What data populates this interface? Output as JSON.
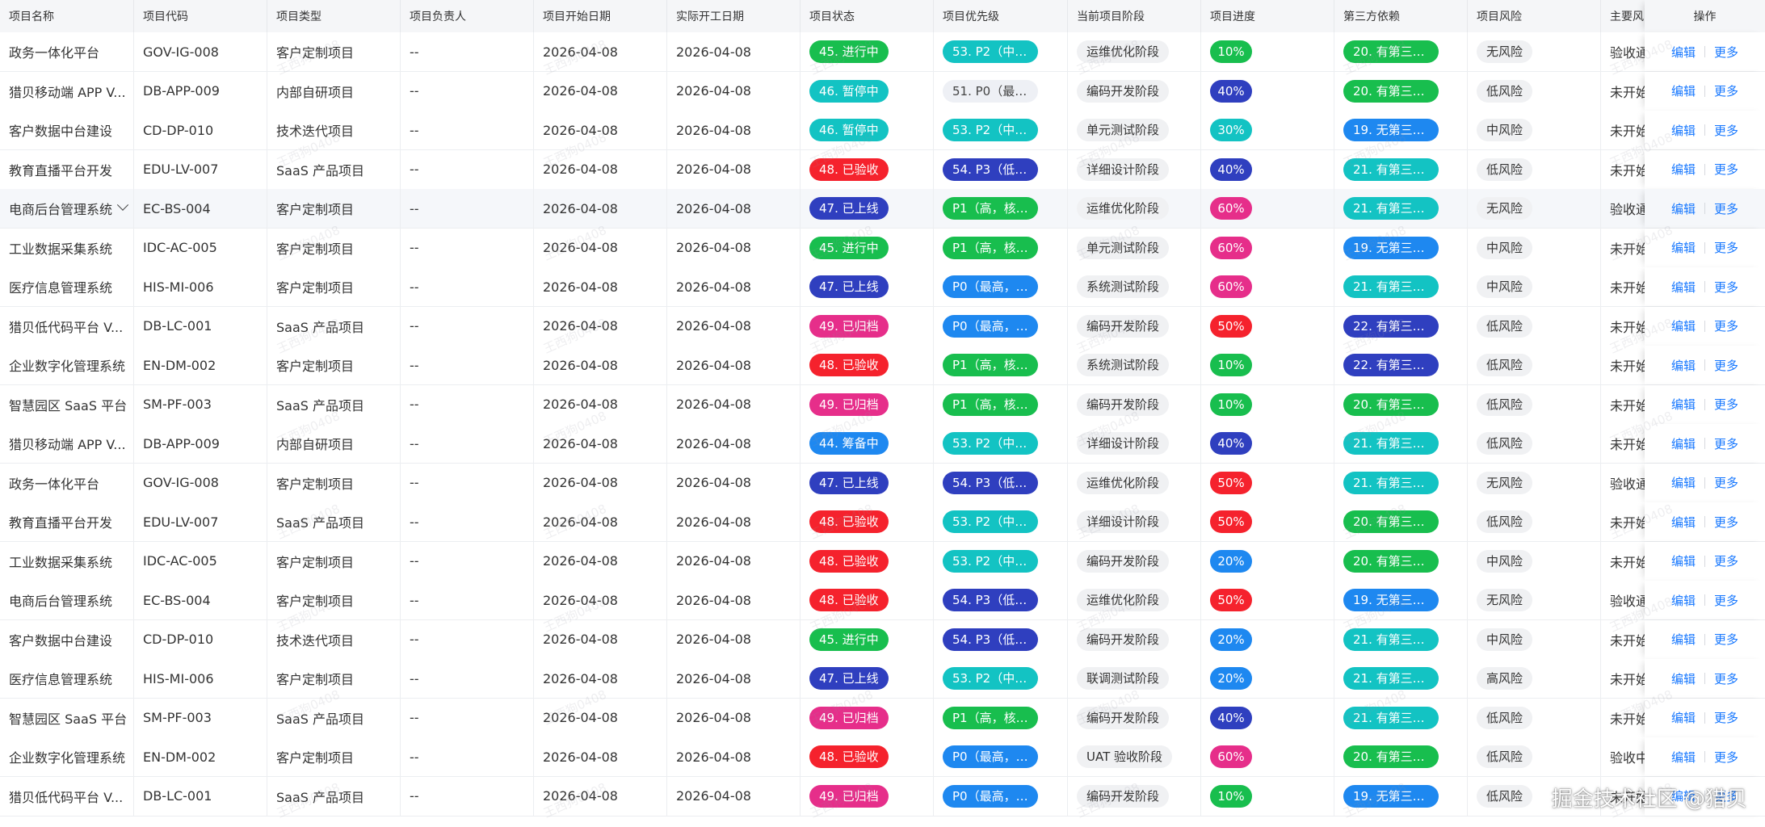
{
  "columns": [
    "项目名称",
    "项目代码",
    "项目类型",
    "项目负责人",
    "项目开始日期",
    "实际开工日期",
    "项目状态",
    "项目优先级",
    "当前项目阶段",
    "项目进度",
    "第三方依赖",
    "项目风险",
    "主要风",
    "操作"
  ],
  "actions": {
    "edit": "编辑",
    "more": "更多"
  },
  "watermark_text": "王西狗0408",
  "brand_text": "掘金技术社区 @猎贝",
  "colors": {
    "green": "#18be4e",
    "teal": "#13c3c3",
    "blue": "#1e88f0",
    "indigo": "#2f3fbf",
    "red": "#f5222d",
    "magenta": "#e62e8a",
    "light": "#eef0f5",
    "link": "#1677ff"
  },
  "rows": [
    {
      "name": "政务一体化平台",
      "code": "GOV-IG-008",
      "type": "客户定制项目",
      "owner": "--",
      "start": "2026-04-08",
      "actual": "2026-04-08",
      "status": "45. 进行中",
      "status_color": "green",
      "priority": "53. P2（中，常...",
      "priority_color": "teal",
      "stage": "运维优化阶段",
      "progress": "10%",
      "progress_color": "green",
      "dependency": "20. 有第三方接...",
      "dependency_color": "green",
      "risk": "无风险",
      "main_risk": "验收通"
    },
    {
      "name": "猎贝移动端 APP V...",
      "code": "DB-APP-009",
      "type": "内部自研项目",
      "owner": "--",
      "start": "2026-04-08",
      "actual": "2026-04-08",
      "status": "46. 暂停中",
      "status_color": "teal",
      "priority": "51. P0（最高，...",
      "priority_color": "light",
      "stage": "编码开发阶段",
      "progress": "40%",
      "progress_color": "indigo",
      "dependency": "20. 有第三方接...",
      "dependency_color": "green",
      "risk": "低风险",
      "main_risk": "未开始"
    },
    {
      "name": "客户数据中台建设",
      "code": "CD-DP-010",
      "type": "技术迭代项目",
      "owner": "--",
      "start": "2026-04-08",
      "actual": "2026-04-08",
      "status": "46. 暂停中",
      "status_color": "teal",
      "priority": "53. P2（中，常...",
      "priority_color": "teal",
      "stage": "单元测试阶段",
      "progress": "30%",
      "progress_color": "teal",
      "dependency": "19. 无第三方依赖",
      "dependency_color": "blue",
      "risk": "中风险",
      "main_risk": "未开始"
    },
    {
      "name": "教育直播平台开发",
      "code": "EDU-LV-007",
      "type": "SaaS 产品项目",
      "owner": "--",
      "start": "2026-04-08",
      "actual": "2026-04-08",
      "status": "48. 已验收",
      "status_color": "red",
      "priority": "54. P3（低，优...",
      "priority_color": "indigo",
      "stage": "详细设计阶段",
      "progress": "40%",
      "progress_color": "indigo",
      "dependency": "21. 有第三方组...",
      "dependency_color": "teal",
      "risk": "低风险",
      "main_risk": "未开始"
    },
    {
      "name": "电商后台管理系统",
      "code": "EC-BS-004",
      "type": "客户定制项目",
      "owner": "--",
      "start": "2026-04-08",
      "actual": "2026-04-08",
      "status": "47. 已上线",
      "status_color": "indigo",
      "priority": "P1（高，核心...",
      "priority_color": "green",
      "stage": "运维优化阶段",
      "progress": "60%",
      "progress_color": "magenta",
      "dependency": "21. 有第三方组...",
      "dependency_color": "teal",
      "risk": "无风险",
      "main_risk": "验收通"
    },
    {
      "name": "工业数据采集系统",
      "code": "IDC-AC-005",
      "type": "客户定制项目",
      "owner": "--",
      "start": "2026-04-08",
      "actual": "2026-04-08",
      "status": "45. 进行中",
      "status_color": "green",
      "priority": "P1（高，核心...",
      "priority_color": "green",
      "stage": "单元测试阶段",
      "progress": "60%",
      "progress_color": "magenta",
      "dependency": "19. 无第三方依赖",
      "dependency_color": "blue",
      "risk": "中风险",
      "main_risk": "未开始"
    },
    {
      "name": "医疗信息管理系统",
      "code": "HIS-MI-006",
      "type": "客户定制项目",
      "owner": "--",
      "start": "2026-04-08",
      "actual": "2026-04-08",
      "status": "47. 已上线",
      "status_color": "indigo",
      "priority": "P0（最高，核...",
      "priority_color": "blue",
      "stage": "系统测试阶段",
      "progress": "60%",
      "progress_color": "magenta",
      "dependency": "21. 有第三方组...",
      "dependency_color": "teal",
      "risk": "中风险",
      "main_risk": "未开始"
    },
    {
      "name": "猎贝低代码平台 V...",
      "code": "DB-LC-001",
      "type": "SaaS 产品项目",
      "owner": "--",
      "start": "2026-04-08",
      "actual": "2026-04-08",
      "status": "49. 已归档",
      "status_color": "magenta",
      "priority": "P0（最高，核...",
      "priority_color": "blue",
      "stage": "编码开发阶段",
      "progress": "50%",
      "progress_color": "red",
      "dependency": "22. 有第三方服...",
      "dependency_color": "indigo",
      "risk": "低风险",
      "main_risk": "未开始"
    },
    {
      "name": "企业数字化管理系统",
      "code": "EN-DM-002",
      "type": "客户定制项目",
      "owner": "--",
      "start": "2026-04-08",
      "actual": "2026-04-08",
      "status": "48. 已验收",
      "status_color": "red",
      "priority": "P1（高，核心...",
      "priority_color": "green",
      "stage": "系统测试阶段",
      "progress": "10%",
      "progress_color": "green",
      "dependency": "22. 有第三方服...",
      "dependency_color": "indigo",
      "risk": "低风险",
      "main_risk": "未开始"
    },
    {
      "name": "智慧园区 SaaS 平台",
      "code": "SM-PF-003",
      "type": "SaaS 产品项目",
      "owner": "--",
      "start": "2026-04-08",
      "actual": "2026-04-08",
      "status": "49. 已归档",
      "status_color": "magenta",
      "priority": "P1（高，核心...",
      "priority_color": "green",
      "stage": "编码开发阶段",
      "progress": "10%",
      "progress_color": "green",
      "dependency": "20. 有第三方接...",
      "dependency_color": "green",
      "risk": "低风险",
      "main_risk": "未开始"
    },
    {
      "name": "猎贝移动端 APP V...",
      "code": "DB-APP-009",
      "type": "内部自研项目",
      "owner": "--",
      "start": "2026-04-08",
      "actual": "2026-04-08",
      "status": "44. 筹备中",
      "status_color": "blue",
      "priority": "53. P2（中，常...",
      "priority_color": "teal",
      "stage": "详细设计阶段",
      "progress": "40%",
      "progress_color": "indigo",
      "dependency": "21. 有第三方组...",
      "dependency_color": "teal",
      "risk": "低风险",
      "main_risk": "未开始"
    },
    {
      "name": "政务一体化平台",
      "code": "GOV-IG-008",
      "type": "客户定制项目",
      "owner": "--",
      "start": "2026-04-08",
      "actual": "2026-04-08",
      "status": "47. 已上线",
      "status_color": "indigo",
      "priority": "54. P3（低，优...",
      "priority_color": "indigo",
      "stage": "运维优化阶段",
      "progress": "50%",
      "progress_color": "red",
      "dependency": "21. 有第三方组...",
      "dependency_color": "teal",
      "risk": "无风险",
      "main_risk": "验收通"
    },
    {
      "name": "教育直播平台开发",
      "code": "EDU-LV-007",
      "type": "SaaS 产品项目",
      "owner": "--",
      "start": "2026-04-08",
      "actual": "2026-04-08",
      "status": "48. 已验收",
      "status_color": "red",
      "priority": "53. P2（中，常...",
      "priority_color": "teal",
      "stage": "详细设计阶段",
      "progress": "50%",
      "progress_color": "red",
      "dependency": "20. 有第三方接...",
      "dependency_color": "green",
      "risk": "低风险",
      "main_risk": "未开始"
    },
    {
      "name": "工业数据采集系统",
      "code": "IDC-AC-005",
      "type": "客户定制项目",
      "owner": "--",
      "start": "2026-04-08",
      "actual": "2026-04-08",
      "status": "48. 已验收",
      "status_color": "red",
      "priority": "53. P2（中，常...",
      "priority_color": "teal",
      "stage": "编码开发阶段",
      "progress": "20%",
      "progress_color": "blue",
      "dependency": "20. 有第三方接...",
      "dependency_color": "green",
      "risk": "中风险",
      "main_risk": "未开始"
    },
    {
      "name": "电商后台管理系统",
      "code": "EC-BS-004",
      "type": "客户定制项目",
      "owner": "--",
      "start": "2026-04-08",
      "actual": "2026-04-08",
      "status": "48. 已验收",
      "status_color": "red",
      "priority": "54. P3（低，优...",
      "priority_color": "indigo",
      "stage": "运维优化阶段",
      "progress": "50%",
      "progress_color": "red",
      "dependency": "19. 无第三方依赖",
      "dependency_color": "blue",
      "risk": "无风险",
      "main_risk": "验收通"
    },
    {
      "name": "客户数据中台建设",
      "code": "CD-DP-010",
      "type": "技术迭代项目",
      "owner": "--",
      "start": "2026-04-08",
      "actual": "2026-04-08",
      "status": "45. 进行中",
      "status_color": "green",
      "priority": "54. P3（低，优...",
      "priority_color": "indigo",
      "stage": "编码开发阶段",
      "progress": "20%",
      "progress_color": "blue",
      "dependency": "21. 有第三方组...",
      "dependency_color": "teal",
      "risk": "中风险",
      "main_risk": "未开始"
    },
    {
      "name": "医疗信息管理系统",
      "code": "HIS-MI-006",
      "type": "客户定制项目",
      "owner": "--",
      "start": "2026-04-08",
      "actual": "2026-04-08",
      "status": "47. 已上线",
      "status_color": "indigo",
      "priority": "53. P2（中，常...",
      "priority_color": "teal",
      "stage": "联调测试阶段",
      "progress": "20%",
      "progress_color": "blue",
      "dependency": "21. 有第三方组...",
      "dependency_color": "teal",
      "risk": "高风险",
      "main_risk": "未开始"
    },
    {
      "name": "智慧园区 SaaS 平台",
      "code": "SM-PF-003",
      "type": "SaaS 产品项目",
      "owner": "--",
      "start": "2026-04-08",
      "actual": "2026-04-08",
      "status": "49. 已归档",
      "status_color": "magenta",
      "priority": "P1（高，核心...",
      "priority_color": "green",
      "stage": "编码开发阶段",
      "progress": "40%",
      "progress_color": "indigo",
      "dependency": "21. 有第三方组...",
      "dependency_color": "teal",
      "risk": "低风险",
      "main_risk": "未开始"
    },
    {
      "name": "企业数字化管理系统",
      "code": "EN-DM-002",
      "type": "客户定制项目",
      "owner": "--",
      "start": "2026-04-08",
      "actual": "2026-04-08",
      "status": "48. 已验收",
      "status_color": "red",
      "priority": "P0（最高，核...",
      "priority_color": "blue",
      "stage": "UAT 验收阶段",
      "progress": "60%",
      "progress_color": "magenta",
      "dependency": "20. 有第三方接...",
      "dependency_color": "green",
      "risk": "低风险",
      "main_risk": "验收中"
    },
    {
      "name": "猎贝低代码平台 V...",
      "code": "DB-LC-001",
      "type": "SaaS 产品项目",
      "owner": "--",
      "start": "2026-04-08",
      "actual": "2026-04-08",
      "status": "49. 已归档",
      "status_color": "magenta",
      "priority": "P0（最高，核...",
      "priority_color": "blue",
      "stage": "编码开发阶段",
      "progress": "10%",
      "progress_color": "green",
      "dependency": "19. 无第三方依赖",
      "dependency_color": "blue",
      "risk": "低风险",
      "main_risk": "未开始"
    }
  ]
}
